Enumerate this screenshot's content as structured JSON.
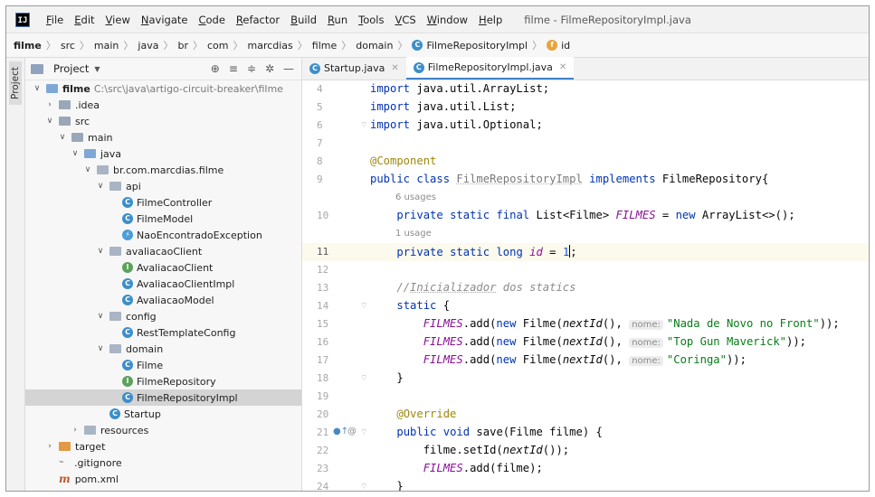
{
  "window": {
    "title": "filme - FilmeRepositoryImpl.java"
  },
  "menu": [
    "File",
    "Edit",
    "View",
    "Navigate",
    "Code",
    "Refactor",
    "Build",
    "Run",
    "Tools",
    "VCS",
    "Window",
    "Help"
  ],
  "breadcrumbs": [
    "filme",
    "src",
    "main",
    "java",
    "br",
    "com",
    "marcdias",
    "filme",
    "domain",
    "FilmeRepositoryImpl",
    "id"
  ],
  "sidebar_tool": "Project",
  "project_panel": {
    "title": "Project",
    "tree": [
      {
        "label": "filme",
        "path": "C:\\src\\java\\artigo-circuit-breaker\\filme",
        "depth": 0,
        "expanded": true,
        "icon": "folder-root"
      },
      {
        "label": ".idea",
        "depth": 1,
        "expanded": false,
        "icon": "folder"
      },
      {
        "label": "src",
        "depth": 1,
        "expanded": true,
        "icon": "folder"
      },
      {
        "label": "main",
        "depth": 2,
        "expanded": true,
        "icon": "folder"
      },
      {
        "label": "java",
        "depth": 3,
        "expanded": true,
        "icon": "folder-blue"
      },
      {
        "label": "br.com.marcdias.filme",
        "depth": 4,
        "expanded": true,
        "icon": "package"
      },
      {
        "label": "api",
        "depth": 5,
        "expanded": true,
        "icon": "package"
      },
      {
        "label": "FilmeController",
        "depth": 6,
        "icon": "class"
      },
      {
        "label": "FilmeModel",
        "depth": 6,
        "icon": "class"
      },
      {
        "label": "NaoEncontradoException",
        "depth": 6,
        "icon": "exception"
      },
      {
        "label": "avaliacaoClient",
        "depth": 5,
        "expanded": true,
        "icon": "package"
      },
      {
        "label": "AvaliacaoClient",
        "depth": 6,
        "icon": "interface"
      },
      {
        "label": "AvaliacaoClientImpl",
        "depth": 6,
        "icon": "class"
      },
      {
        "label": "AvaliacaoModel",
        "depth": 6,
        "icon": "class"
      },
      {
        "label": "config",
        "depth": 5,
        "expanded": true,
        "icon": "package"
      },
      {
        "label": "RestTemplateConfig",
        "depth": 6,
        "icon": "class"
      },
      {
        "label": "domain",
        "depth": 5,
        "expanded": true,
        "icon": "package"
      },
      {
        "label": "Filme",
        "depth": 6,
        "icon": "class"
      },
      {
        "label": "FilmeRepository",
        "depth": 6,
        "icon": "interface"
      },
      {
        "label": "FilmeRepositoryImpl",
        "depth": 6,
        "icon": "class",
        "selected": true
      },
      {
        "label": "Startup",
        "depth": 5,
        "icon": "class-main"
      },
      {
        "label": "resources",
        "depth": 3,
        "expanded": false,
        "icon": "folder-res"
      },
      {
        "label": "target",
        "depth": 1,
        "expanded": false,
        "icon": "folder-orange"
      },
      {
        "label": ".gitignore",
        "depth": 1,
        "icon": "gitignore"
      },
      {
        "label": "pom.xml",
        "depth": 1,
        "icon": "maven"
      }
    ]
  },
  "tabs": [
    {
      "label": "Startup.java",
      "active": false
    },
    {
      "label": "FilmeRepositoryImpl.java",
      "active": true
    }
  ],
  "code": {
    "lines": [
      {
        "n": "4",
        "text": "import java.util.ArrayList;"
      },
      {
        "n": "5",
        "text": "import java.util.List;"
      },
      {
        "n": "6",
        "text": "import java.util.Optional;"
      },
      {
        "n": "7",
        "text": ""
      },
      {
        "n": "8",
        "text": "@Component"
      },
      {
        "n": "9",
        "text": "public class FilmeRepositoryImpl implements FilmeRepository{"
      },
      {
        "n": "",
        "text": "",
        "usage": "6 usages"
      },
      {
        "n": "10",
        "text": "    private static final List<Filme> FILMES = new ArrayList<>();"
      },
      {
        "n": "",
        "text": "",
        "usage": "1 usage"
      },
      {
        "n": "11",
        "text": "    private static long id = 1;",
        "current": true
      },
      {
        "n": "12",
        "text": ""
      },
      {
        "n": "13",
        "text": "    //Inicializador dos statics"
      },
      {
        "n": "14",
        "text": "    static {"
      },
      {
        "n": "15",
        "text": "        FILMES.add(new Filme(nextId(), nome: \"Nada de Novo no Front\"));"
      },
      {
        "n": "16",
        "text": "        FILMES.add(new Filme(nextId(), nome: \"Top Gun Maverick\"));"
      },
      {
        "n": "17",
        "text": "        FILMES.add(new Filme(nextId(), nome: \"Coringa\"));"
      },
      {
        "n": "18",
        "text": "    }"
      },
      {
        "n": "19",
        "text": ""
      },
      {
        "n": "20",
        "text": "    @Override"
      },
      {
        "n": "21",
        "text": "    public void save(Filme filme) {"
      },
      {
        "n": "22",
        "text": "        filme.setId(nextId());"
      },
      {
        "n": "23",
        "text": "        FILMES.add(filme);"
      },
      {
        "n": "24",
        "text": "    }"
      }
    ]
  }
}
